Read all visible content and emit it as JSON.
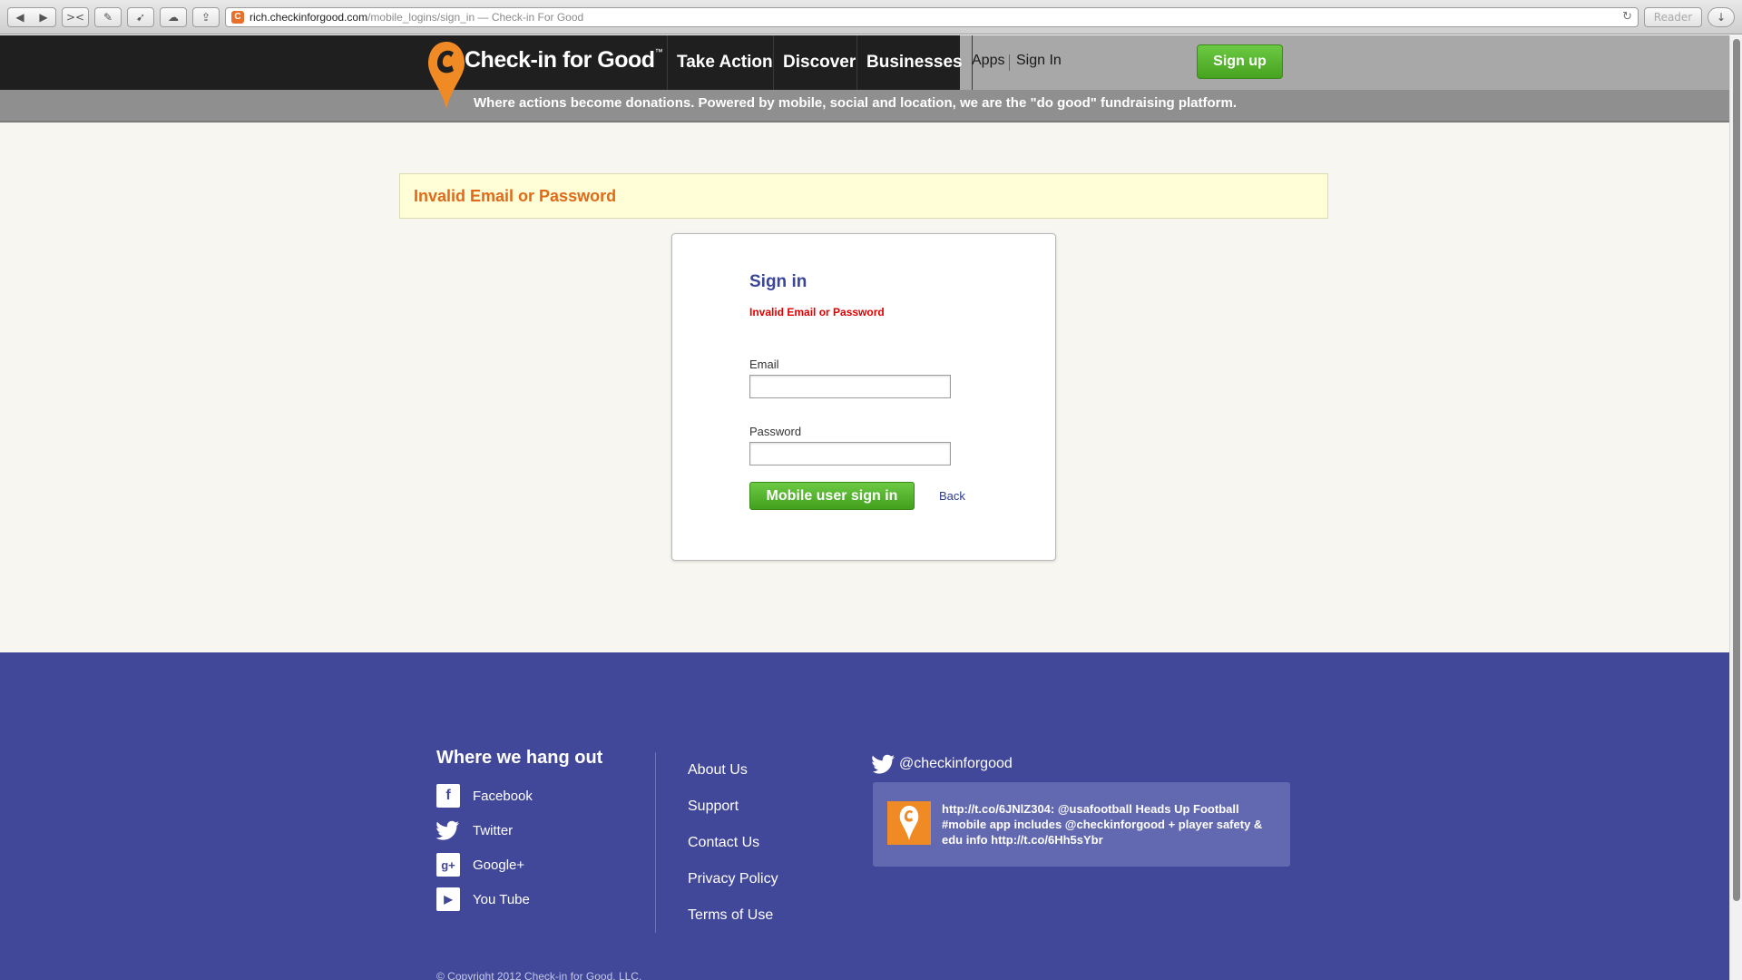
{
  "browser": {
    "url_domain": "rich.checkinforgood.com",
    "url_path": "/mobile_logins/sign_in",
    "title_sep": " — ",
    "page_title": "Check-in For Good",
    "reader_label": "Reader"
  },
  "header": {
    "logo_text": "Check-in for Good",
    "logo_tm": "™",
    "nav": [
      "Take Action",
      "Discover",
      "Businesses"
    ],
    "apps_label": "Apps",
    "signin_label": "Sign In",
    "signup_label": "Sign up",
    "tagline": "Where actions become donations. Powered by mobile, social and location, we are the \"do good\" fundraising platform."
  },
  "alert": {
    "message": "Invalid Email or Password"
  },
  "signin": {
    "title": "Sign in",
    "error": "Invalid Email or Password",
    "email_label": "Email",
    "email_value": "",
    "password_label": "Password",
    "password_value": "",
    "submit_label": "Mobile user sign in",
    "back_label": "Back"
  },
  "footer": {
    "heading": "Where we hang out",
    "social": [
      {
        "label": "Facebook",
        "icon": "facebook-icon"
      },
      {
        "label": "Twitter",
        "icon": "twitter-icon"
      },
      {
        "label": "Google+",
        "icon": "google-plus-icon"
      },
      {
        "label": "You Tube",
        "icon": "youtube-icon"
      }
    ],
    "links": [
      "About Us",
      "Support",
      "Contact Us",
      "Privacy Policy",
      "Terms of Use"
    ],
    "twitter_handle": "@checkinforgood",
    "tweet": "http://t.co/6JNlZ304: @usafootball Heads Up Football #mobile app includes @checkinforgood + player safety & edu info http://t.co/6Hh5sYbr",
    "copyright": "© Copyright 2012 Check-in for Good, LLC."
  },
  "colors": {
    "brand_orange": "#f08a24",
    "signup_green": "#55b52c",
    "footer_blue": "#414799",
    "error_red": "#e00000",
    "title_blue": "#3b4699"
  }
}
